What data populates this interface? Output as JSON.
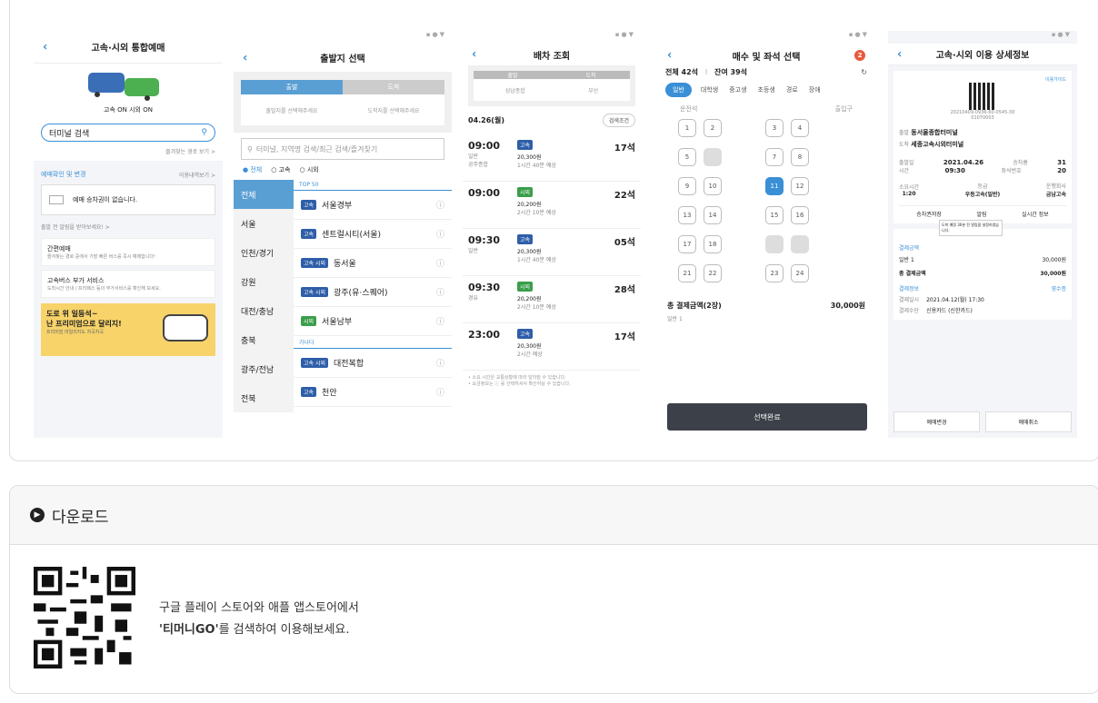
{
  "p1": {
    "title": "고속·시외 통합예매",
    "toggle": "고속 ON 시외 ON",
    "search": "터미널 검색",
    "fav": "즐겨찾는 경로 보기 >",
    "sec": "예매확인 및 변경",
    "hist": "이용내역보기 >",
    "noticket": "예매 승차권이 없습니다.",
    "board": "출발 전 알림을 받아보세요! >",
    "m1t": "간편예매",
    "m1s": "즐겨찾는 경로 중에서 가장 빠른 버스를 즉시 예매합니다!",
    "m2t": "고속버스 부가 서비스",
    "m2s": "도착시간 안내 / 프리패스 등의 부가서비스를 확인해 보세요.",
    "banner1": "도로 위 일등석~",
    "banner2": "난 프리미엄으로 달리지!",
    "banner3": "프리미엄 마일리지도 차곡차곡"
  },
  "p2": {
    "title": "출발지 선택",
    "dep": "출발",
    "arr": "도착",
    "depph": "출발지를 선택해주세요",
    "arrph": "도착지를 선택해주세요",
    "search": "터미널, 지역명 검색/최근 검색/즐겨찾기",
    "r1": "전체",
    "r2": "고속",
    "r3": "시외",
    "regions": [
      "전체",
      "서울",
      "인천/경기",
      "강원",
      "대전/충남",
      "충북",
      "광주/전남",
      "전북"
    ],
    "top": "TOP 50",
    "kana": "가나다",
    "terms": [
      {
        "t": "고속",
        "n": "서울경부"
      },
      {
        "t": "고속",
        "n": "센트럴시티(서울)"
      },
      {
        "t": "고속 시외",
        "n": "동서울"
      },
      {
        "t": "고속 시외",
        "n": "광주(유·스퀘어)"
      },
      {
        "t": "시외",
        "n": "서울남부"
      },
      {
        "t": "고속 시외",
        "n": "대전복합"
      },
      {
        "t": "고속",
        "n": "천안"
      }
    ]
  },
  "p3": {
    "title": "배차 조회",
    "dep": "출발",
    "arr": "도착",
    "from": "성남종합",
    "to": "부산",
    "date": "04.26(월)",
    "cond": "검색조건",
    "rows": [
      {
        "time": "09:00",
        "sub": "일반",
        "tag": "고속",
        "price": "20,300원",
        "dur": "1시간 40분 예상",
        "seat": "17석",
        "sub2": "공주종합"
      },
      {
        "time": "09:00",
        "sub": "",
        "tag": "시외",
        "price": "20,200원",
        "dur": "2시간 10분 예상",
        "seat": "22석",
        "sub2": ""
      },
      {
        "time": "09:30",
        "sub": "일반",
        "tag": "고속",
        "price": "20,300원",
        "dur": "1시간 40분 예상",
        "seat": "05석",
        "sub2": ""
      },
      {
        "time": "09:30",
        "sub": "경유",
        "tag": "시외",
        "price": "20,200원",
        "dur": "2시간 10분 예상",
        "seat": "28석",
        "sub2": ""
      },
      {
        "time": "23:00",
        "sub": "",
        "tag": "고속",
        "price": "20,300원",
        "dur": "2시간 예상",
        "seat": "17석",
        "sub2": ""
      }
    ],
    "note1": "• 소요 시간은 교통상황에 따라 달라질 수 있습니다.",
    "note2": "• 요금정보는 ⓘ 를 선택하셔서 확인하실 수 있습니다."
  },
  "p4": {
    "title": "매수 및 좌석 선택",
    "total": "전체 42석",
    "left": "잔여 39석",
    "tabs": [
      "일반",
      "대학생",
      "중고생",
      "초등생",
      "경로",
      "장애"
    ],
    "front": "운전석",
    "door": "출입구",
    "paylabel": "총 결제금액(2장)",
    "pay": "30,000원",
    "paysub": "일반 1",
    "done": "선택완료",
    "badge": "2",
    "seats": [
      "1",
      "2",
      "3",
      "4",
      "5",
      "",
      "7",
      "8",
      "9",
      "10",
      "11",
      "12",
      "13",
      "14",
      "15",
      "16",
      "17",
      "18",
      "",
      "",
      "21",
      "22",
      "23",
      "24"
    ]
  },
  "p5": {
    "title": "고속·시외 이용 상세정보",
    "link": "이용가이드",
    "code": "20210409-0936-60-0545-30",
    "code2": "01070003",
    "from": "동서울종합터미널",
    "to": "세종고속시외터미널",
    "fromL": "출발",
    "toL": "도착",
    "dateL": "출발일",
    "date": "2021.04.26",
    "timeL": "시간",
    "time": "09:30",
    "seatL": "승차홈",
    "seat": "31",
    "seatNoL": "좌석번호",
    "seatNo": "20",
    "durL": "소요시간",
    "dur": "1:20",
    "gradeL": "등급",
    "grade": "우등고속(일반)",
    "compL": "운행회사",
    "comp": "금남고속",
    "b1": "승차권저장",
    "b2": "알림",
    "b3": "실시간 정보",
    "tip": "도착 예정 30분 전 알림을 설정하였습니다.",
    "payL": "결제금액",
    "ordL": "일반 1",
    "ord": "30,000원",
    "totL": "총 결제금액",
    "tot": "30,000원",
    "payInfo": "결제정보",
    "payDateL": "결제일시",
    "payDate": "2021.04.12(월) 17:30",
    "payMethodL": "결제수단",
    "payMethod": "신용카드 (신한카드)",
    "receipt": "영수증",
    "chg": "예매변경",
    "cancel": "예매취소"
  },
  "download": {
    "title": "다운로드",
    "line1": "구글 플레이 스토어와 애플 앱스토어에서",
    "app": "'티머니GO'",
    "line2": "를 검색하여 이용해보세요."
  }
}
